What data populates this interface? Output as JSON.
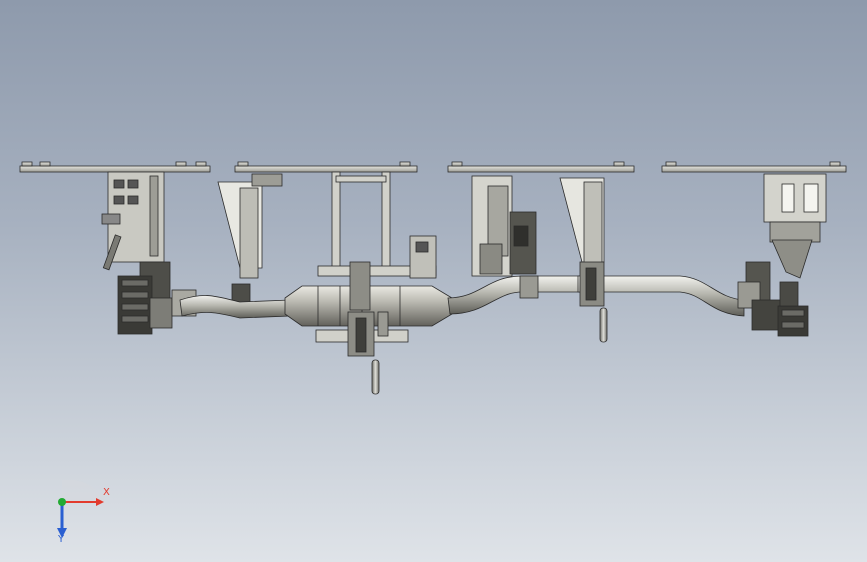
{
  "viewport": {
    "background_top": "#8e9aac",
    "background_bottom": "#dfe3e8",
    "content": "exhaust-pipe-fixture-assembly"
  },
  "triad": {
    "x_label": "X",
    "y_label": "Y",
    "x_color": "#e23b2e",
    "y_color": "#2a5fd1",
    "origin_color": "#22aa33"
  }
}
